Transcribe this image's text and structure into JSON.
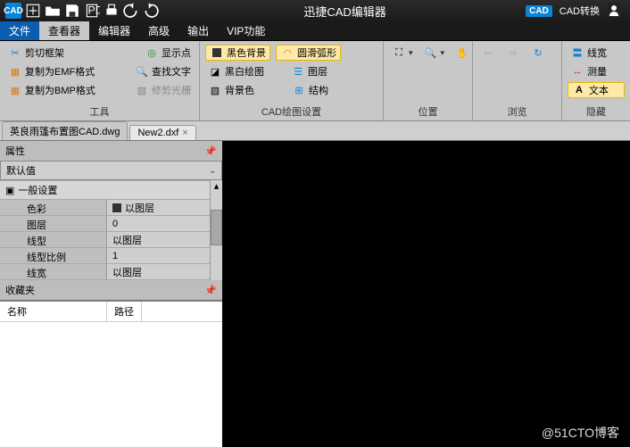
{
  "title": "迅捷CAD编辑器",
  "title_right": {
    "badge": "CAD",
    "convert": "CAD转换"
  },
  "menu": {
    "file": "文件",
    "viewer": "查看器",
    "editor": "编辑器",
    "advanced": "高级",
    "output": "输出",
    "vip": "VIP功能"
  },
  "ribbon": {
    "tools": {
      "label": "工具",
      "cut_frame": "剪切框架",
      "show_points": "显示点",
      "copy_emf": "复制为EMF格式",
      "find_text": "查找文字",
      "copy_bmp": "复制为BMP格式",
      "edit_cursor": "修剪光栅"
    },
    "cad_settings": {
      "label": "CAD绘图设置",
      "black_bg": "黑色背景",
      "smooth_arc": "圆滑弧形",
      "bw_draw": "黑白绘图",
      "layers": "图层",
      "bg_color": "背景色",
      "structure": "结构"
    },
    "position": {
      "label": "位置"
    },
    "browse": {
      "label": "浏览"
    },
    "hide": {
      "label": "隐藏",
      "linewidth": "线宽",
      "measure": "测量",
      "text": "文本"
    }
  },
  "tabs": {
    "t1": "英良雨篷布置图CAD.dwg",
    "t2": "New2.dxf"
  },
  "panels": {
    "properties": "属性",
    "default_value": "默认值",
    "general": "一般设置",
    "favorites": "收藏夹",
    "fav_name": "名称",
    "fav_path": "路径"
  },
  "props": {
    "color_k": "色彩",
    "color_v": "以图层",
    "layer_k": "图层",
    "layer_v": "0",
    "linetype_k": "线型",
    "linetype_v": "以图层",
    "ltscale_k": "线型比例",
    "ltscale_v": "1",
    "linewidth_k": "线宽",
    "linewidth_v": "以图层"
  },
  "watermark": "@51CTO博客"
}
